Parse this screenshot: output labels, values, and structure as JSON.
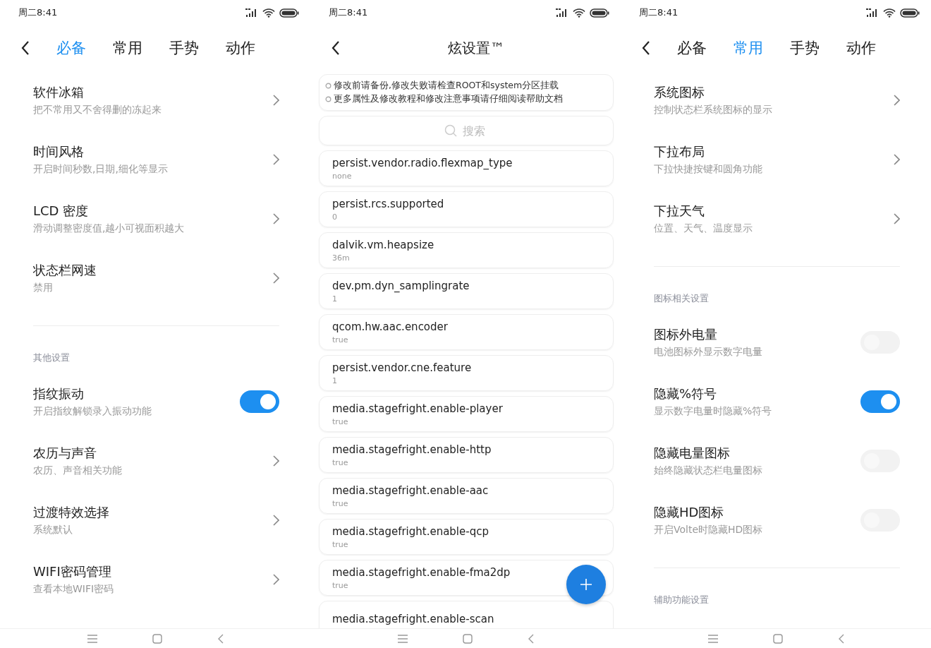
{
  "screens": [
    {
      "kind": "tabbed",
      "status_time": "周二8:41",
      "tabs": [
        {
          "label": "必备",
          "selected": true
        },
        {
          "label": "常用",
          "selected": false
        },
        {
          "label": "手势",
          "selected": false
        },
        {
          "label": "动作",
          "selected": false
        }
      ],
      "sections": [
        {
          "items": [
            {
              "kind": "link",
              "title": "软件冰箱",
              "subtitle": "把不常用又不舍得删的冻起来"
            },
            {
              "kind": "link",
              "title": "时间风格",
              "subtitle": "开启时间秒数,日期,细化等显示"
            },
            {
              "kind": "link",
              "title": "LCD 密度",
              "subtitle": "滑动调整密度值,越小可视面积越大"
            },
            {
              "kind": "link",
              "title": "状态栏网速",
              "subtitle": "禁用"
            }
          ]
        },
        {
          "header": "其他设置",
          "items": [
            {
              "kind": "toggle",
              "title": "指纹振动",
              "subtitle": "开启指纹解锁录入振动功能",
              "on": true
            },
            {
              "kind": "link",
              "title": "农历与声音",
              "subtitle": "农历、声音相关功能"
            },
            {
              "kind": "link",
              "title": "过渡特效选择",
              "subtitle": "系统默认"
            },
            {
              "kind": "link",
              "title": "WIFI密码管理",
              "subtitle": "查看本地WIFI密码"
            }
          ]
        }
      ]
    },
    {
      "kind": "properties",
      "status_time": "周二8:41",
      "title": "炫设置™",
      "notices": [
        "修改前请备份,修改失败请检查ROOT和system分区挂载",
        "更多属性及修改教程和修改注意事项请仔细阅读帮助文档"
      ],
      "search": {
        "placeholder": "搜索"
      },
      "properties": [
        {
          "name": "persist.vendor.radio.flexmap_type",
          "value": "none"
        },
        {
          "name": "persist.rcs.supported",
          "value": "0"
        },
        {
          "name": "dalvik.vm.heapsize",
          "value": "36m"
        },
        {
          "name": "dev.pm.dyn_samplingrate",
          "value": "1"
        },
        {
          "name": "qcom.hw.aac.encoder",
          "value": "true"
        },
        {
          "name": "persist.vendor.cne.feature",
          "value": "1"
        },
        {
          "name": "media.stagefright.enable-player",
          "value": "true"
        },
        {
          "name": "media.stagefright.enable-http",
          "value": "true"
        },
        {
          "name": "media.stagefright.enable-aac",
          "value": "true"
        },
        {
          "name": "media.stagefright.enable-qcp",
          "value": "true"
        },
        {
          "name": "media.stagefright.enable-fma2dp",
          "value": "true"
        },
        {
          "name": "media.stagefright.enable-scan"
        }
      ]
    },
    {
      "kind": "tabbed",
      "status_time": "周二8:41",
      "tabs": [
        {
          "label": "必备",
          "selected": false
        },
        {
          "label": "常用",
          "selected": true
        },
        {
          "label": "手势",
          "selected": false
        },
        {
          "label": "动作",
          "selected": false
        }
      ],
      "sections": [
        {
          "items": [
            {
              "kind": "link",
              "title": "系统图标",
              "subtitle": "控制状态栏系统图标的显示"
            },
            {
              "kind": "link",
              "title": "下拉布局",
              "subtitle": "下拉快捷按键和圆角功能"
            },
            {
              "kind": "link",
              "title": "下拉天气",
              "subtitle": "位置、天气、温度显示"
            }
          ]
        },
        {
          "header": "图标相关设置",
          "items": [
            {
              "kind": "toggle",
              "title": "图标外电量",
              "subtitle": "电池图标外显示数字电量",
              "on": false
            },
            {
              "kind": "toggle",
              "title": "隐藏%符号",
              "subtitle": "显示数字电量时隐藏%符号",
              "on": true
            },
            {
              "kind": "toggle",
              "title": "隐藏电量图标",
              "subtitle": "始终隐藏状态栏电量图标",
              "on": false
            },
            {
              "kind": "toggle",
              "title": "隐藏HD图标",
              "subtitle": "开启Volte时隐藏HD图标",
              "on": false
            }
          ]
        },
        {
          "header": "辅助功能设置"
        }
      ]
    }
  ]
}
